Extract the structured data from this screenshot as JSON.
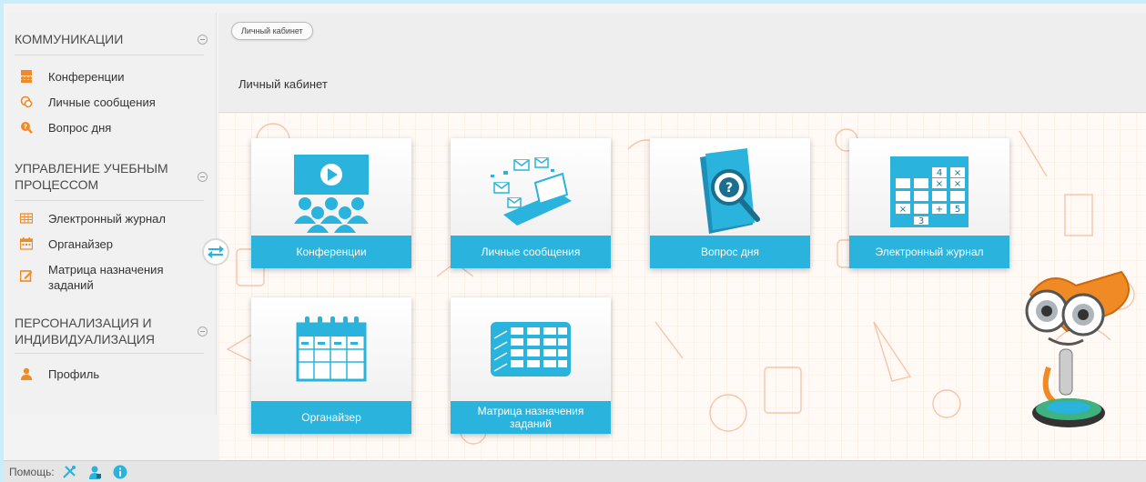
{
  "sidebar": {
    "sections": [
      {
        "title": "КОММУНИКАЦИИ",
        "items": [
          {
            "label": "Конференции",
            "icon": "conference-icon"
          },
          {
            "label": "Личные сообщения",
            "icon": "messages-icon"
          },
          {
            "label": "Вопрос дня",
            "icon": "question-search-icon"
          }
        ]
      },
      {
        "title": "УПРАВЛЕНИЕ УЧЕБНЫМ ПРОЦЕССОМ",
        "items": [
          {
            "label": "Электронный журнал",
            "icon": "journal-icon"
          },
          {
            "label": "Органайзер",
            "icon": "calendar-icon"
          },
          {
            "label": "Матрица назначения заданий",
            "icon": "edit-icon"
          }
        ]
      },
      {
        "title": "ПЕРСОНАЛИЗАЦИЯ И ИНДИВИДУАЛИЗАЦИЯ",
        "items": [
          {
            "label": "Профиль",
            "icon": "user-icon"
          }
        ]
      }
    ]
  },
  "header": {
    "breadcrumb": "Личный кабинет",
    "title": "Личный кабинет"
  },
  "tiles": [
    {
      "label": "Конференции",
      "icon": "conference-icon"
    },
    {
      "label": "Личные сообщения",
      "icon": "messages-laptop-icon"
    },
    {
      "label": "Вопрос дня",
      "icon": "question-book-icon"
    },
    {
      "label": "Электронный журнал",
      "icon": "journal-grid-icon"
    },
    {
      "label": "Органайзер",
      "icon": "calendar-icon"
    },
    {
      "label": "Матрица назначения заданий",
      "icon": "matrix-table-icon"
    }
  ],
  "footer": {
    "help_label": "Помощь:",
    "icons": [
      "tools-icon",
      "support-user-icon",
      "info-icon"
    ]
  },
  "colors": {
    "accent": "#29b3dd",
    "orange": "#f08a24",
    "frame": "#c9eef9"
  }
}
